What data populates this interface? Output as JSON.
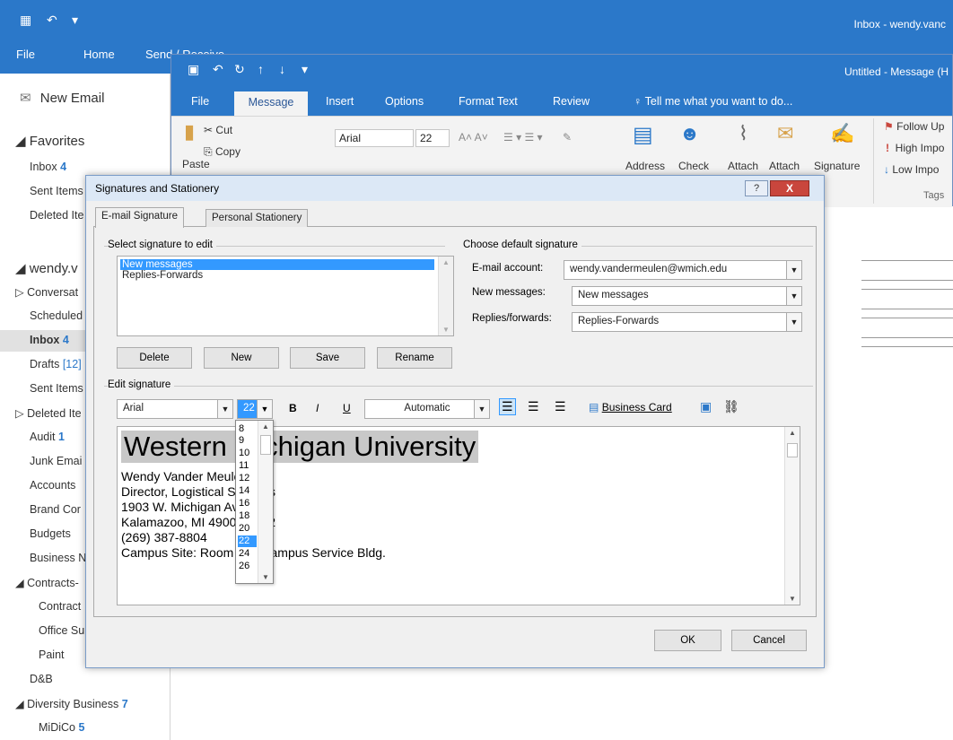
{
  "main_window": {
    "title": "Inbox - wendy.vanc",
    "tabs": [
      "File",
      "Home",
      "Send / Receive"
    ],
    "new_email": "New Email",
    "nav": {
      "favorites": "Favorites",
      "fav_items": [
        {
          "label": "Inbox",
          "count": "4"
        },
        {
          "label": "Sent Items",
          "count": ""
        },
        {
          "label": "Deleted Ite",
          "count": ""
        }
      ],
      "account": "wendy.v",
      "folders": [
        {
          "label": "Conversat",
          "count": ""
        },
        {
          "label": "Scheduled",
          "count": ""
        },
        {
          "label": "Inbox",
          "count": "4"
        },
        {
          "label": "Drafts",
          "count": "[12]"
        },
        {
          "label": "Sent Items",
          "count": ""
        },
        {
          "label": "Deleted Ite",
          "count": ""
        },
        {
          "label": "Audit",
          "count": "1"
        },
        {
          "label": "Junk Emai",
          "count": ""
        },
        {
          "label": "Accounts",
          "count": ""
        },
        {
          "label": "Brand Cor",
          "count": ""
        },
        {
          "label": "Budgets",
          "count": ""
        },
        {
          "label": "Business N",
          "count": ""
        },
        {
          "label": "Contracts-",
          "count": ""
        },
        {
          "label": "Contract",
          "count": ""
        },
        {
          "label": "Office Su",
          "count": ""
        },
        {
          "label": "Paint",
          "count": ""
        },
        {
          "label": "D&B",
          "count": ""
        },
        {
          "label": "Diversity Business",
          "count": "7"
        },
        {
          "label": "MiDiCo",
          "count": "5"
        }
      ]
    }
  },
  "message_window": {
    "title": "Untitled - Message (H",
    "tabs": [
      "File",
      "Message",
      "Insert",
      "Options",
      "Format Text",
      "Review"
    ],
    "tell_me": "Tell me what you want to do...",
    "ribbon": {
      "paste": "Paste",
      "cut": "Cut",
      "copy": "Copy",
      "font": "Arial",
      "size": "22",
      "address": "Address",
      "check": "Check",
      "attach1": "Attach",
      "attach2": "Attach",
      "signature": "Signature",
      "follow_up": "Follow Up",
      "high_importance": "High Impo",
      "low_importance": "Low Impo",
      "tags": "Tags"
    }
  },
  "dialog": {
    "title": "Signatures and Stationery",
    "help": "?",
    "close": "X",
    "tabs": [
      "E-mail Signature",
      "Personal Stationery"
    ],
    "select_label": "Select signature to edit",
    "signatures": [
      "New messages",
      "Replies-Forwards"
    ],
    "buttons": {
      "delete": "Delete",
      "new": "New",
      "save": "Save",
      "rename": "Rename"
    },
    "default_label": "Choose default signature",
    "email_account_label": "E-mail account:",
    "email_account_value": "wendy.vandermeulen@wmich.edu",
    "new_messages_label": "New messages:",
    "new_messages_value": "New messages",
    "replies_label": "Replies/forwards:",
    "replies_value": "Replies-Forwards",
    "edit_label": "Edit signature",
    "toolbar": {
      "font": "Arial",
      "size": "22",
      "bold": "B",
      "italic": "I",
      "underline": "U",
      "color": "Automatic",
      "business_card": "Business Card"
    },
    "editor": {
      "heading": "Western Michigan University",
      "lines": [
        "Wendy Vander Meulen",
        "Director, Logistical Services",
        "1903 W. Michigan Ave",
        "Kalamazoo, MI 49008-5242",
        "(269) 387-8804",
        "Campus Site: Room 102 Campus Service Bldg."
      ]
    },
    "size_options": [
      "8",
      "9",
      "10",
      "11",
      "12",
      "14",
      "16",
      "18",
      "20",
      "22",
      "24",
      "26"
    ],
    "selected_size": "22",
    "ok": "OK",
    "cancel": "Cancel"
  },
  "colors": {
    "outlook_blue": "#2b78c9",
    "selection": "#3399ff",
    "close_red": "#c9463d"
  }
}
